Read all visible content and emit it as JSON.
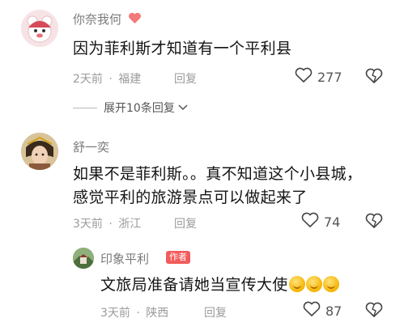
{
  "comments": [
    {
      "username": "你奈我何",
      "text": "因为菲利斯才知道有一个平利县",
      "time": "2天前",
      "location": "福建",
      "reply_label": "回复",
      "likes": "277"
    },
    {
      "username": "舒一奕",
      "text_line1": "如果不是菲利斯。。真不知道这个小县城，",
      "text_line2": "感觉平利的旅游景点可以做起来了",
      "time": "3天前",
      "location": "浙江",
      "reply_label": "回复",
      "likes": "74"
    }
  ],
  "expand_replies": "展开10条回复",
  "author_reply": {
    "username": "印象平利",
    "author_tag": "作者",
    "text": "文旅局准备请她当宣传大使",
    "time": "3天前",
    "location": "陕西",
    "reply_label": "回复",
    "likes": "87"
  },
  "separator": "·",
  "icons": {
    "heart_badge": "heart-icon",
    "like": "like-heart-icon",
    "dislike": "dislike-heart-icon",
    "chevron": "chevron-down-icon",
    "emoji": "clapping-hands-emoji"
  },
  "colors": {
    "heart_badge": "#f27a7a",
    "author_tag_bg": "#f25b5b",
    "meta_text": "#9b9b9b"
  }
}
